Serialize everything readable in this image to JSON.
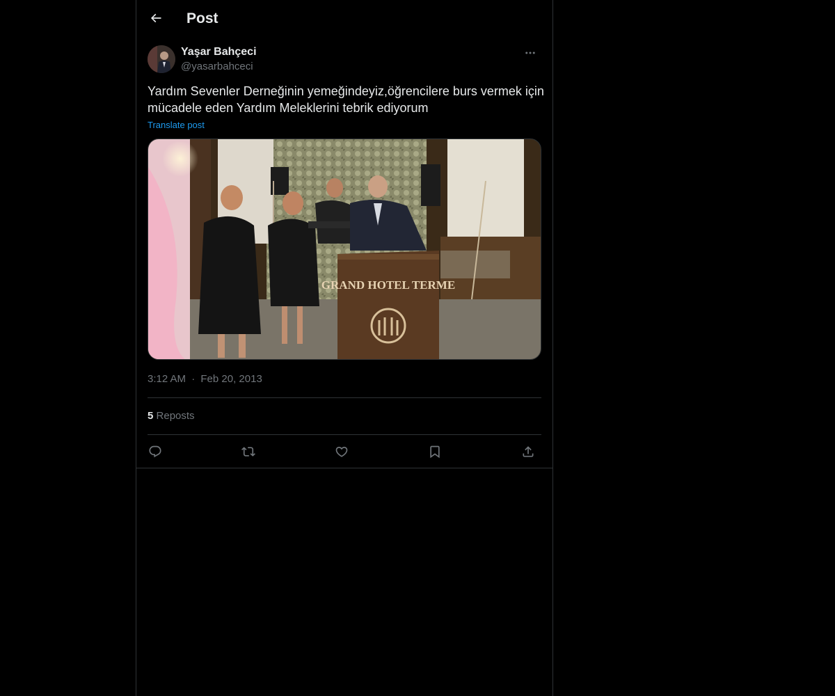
{
  "header": {
    "title": "Post"
  },
  "author": {
    "display_name": "Yaşar Bahçeci",
    "handle": "@yasarbahceci"
  },
  "post": {
    "text": "Yardım Sevenler Derneğinin yemeğindeyiz,öğrencilere burs vermek için mücadele eden Yardım Meleklerini tebrik ediyorum",
    "translate_label": "Translate post",
    "media": {
      "podium_sign": "GRAND HOTEL TERME"
    },
    "time": "3:12 AM",
    "separator": "·",
    "date": "Feb 20, 2013"
  },
  "stats": {
    "reposts_count": "5",
    "reposts_label": "Reposts"
  },
  "actions": [
    "reply-icon",
    "repost-icon",
    "like-icon",
    "bookmark-icon",
    "share-icon"
  ],
  "colors": {
    "background": "#000000",
    "text_primary": "#e7e9ea",
    "text_secondary": "#71767b",
    "accent": "#1d9bf0",
    "border": "#2f3336"
  }
}
